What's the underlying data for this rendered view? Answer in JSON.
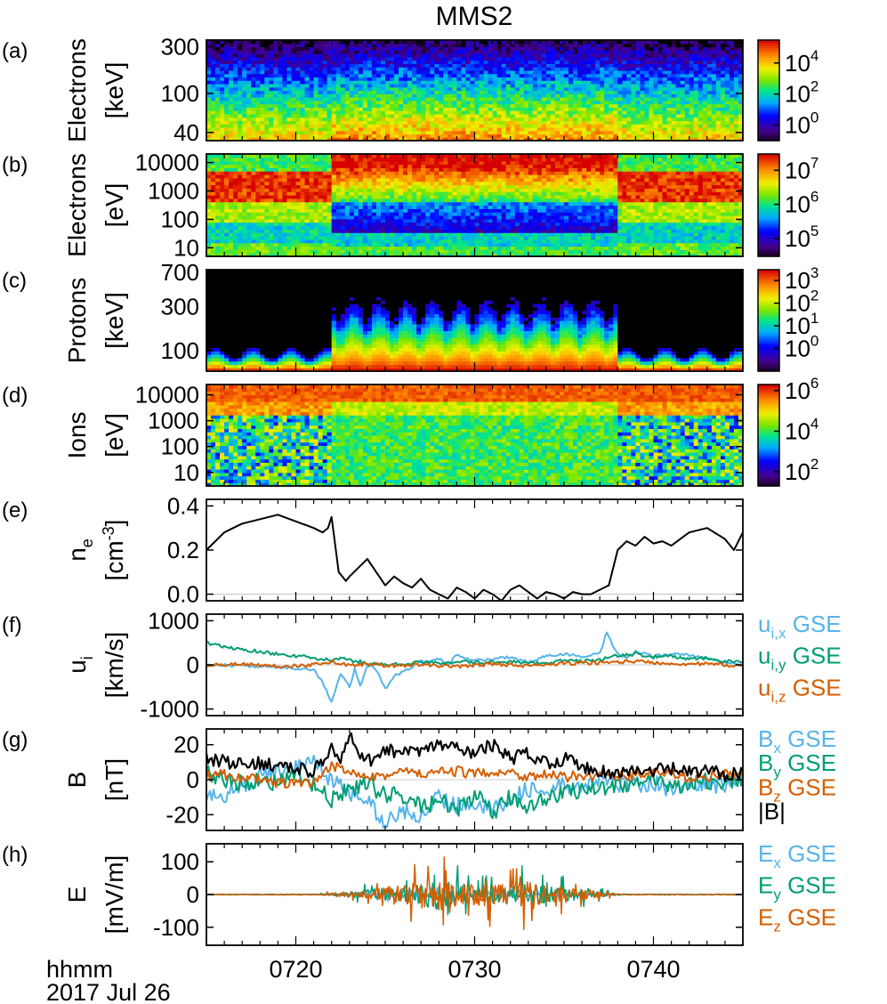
{
  "figure": {
    "title": "MMS2",
    "time_label": "hhmm",
    "date_label": "2017 Jul 26",
    "time_range": [
      "07:15",
      "07:45"
    ],
    "time_ticks": [
      {
        "t": 5,
        "label": "0720"
      },
      {
        "t": 15,
        "label": "0730"
      },
      {
        "t": 25,
        "label": "0740"
      }
    ]
  },
  "chart_data": [
    {
      "id": "a",
      "letter": "(a)",
      "type": "heatmap",
      "ylabel1": "Electrons",
      "ylabel2": "[keV]",
      "ylog": true,
      "ylim": [
        33,
        350
      ],
      "yticks": [
        {
          "v": 40,
          "label": "40"
        },
        {
          "v": 100,
          "label": "100"
        },
        {
          "v": 300,
          "label": "300"
        }
      ],
      "colorbar": {
        "log": true,
        "range": [
          0.1,
          300000
        ],
        "ticks": [
          {
            "v": 1,
            "base": "10",
            "exp": "0"
          },
          {
            "v": 100,
            "base": "10",
            "exp": "2"
          },
          {
            "v": 10000,
            "base": "10",
            "exp": "4"
          }
        ]
      }
    },
    {
      "id": "b",
      "letter": "(b)",
      "type": "heatmap",
      "ylabel1": "Electrons",
      "ylabel2": "[eV]",
      "ylog": true,
      "ylim": [
        5,
        20000
      ],
      "yticks": [
        {
          "v": 10,
          "label": "10"
        },
        {
          "v": 100,
          "label": "100"
        },
        {
          "v": 1000,
          "label": "1000"
        },
        {
          "v": 10000,
          "label": "10000"
        }
      ],
      "colorbar": {
        "log": true,
        "range": [
          30000,
          30000000
        ],
        "ticks": [
          {
            "v": 100000,
            "base": "10",
            "exp": "5"
          },
          {
            "v": 1000000,
            "base": "10",
            "exp": "6"
          },
          {
            "v": 10000000,
            "base": "10",
            "exp": "7"
          }
        ]
      }
    },
    {
      "id": "c",
      "letter": "(c)",
      "type": "heatmap",
      "ylabel1": "Protons",
      "ylabel2": "[keV]",
      "ylog": true,
      "ylim": [
        60,
        750
      ],
      "yticks": [
        {
          "v": 100,
          "label": "100"
        },
        {
          "v": 300,
          "label": "300"
        },
        {
          "v": 700,
          "label": "700"
        }
      ],
      "colorbar": {
        "log": true,
        "range": [
          0.1,
          3000
        ],
        "ticks": [
          {
            "v": 1,
            "base": "10",
            "exp": "0"
          },
          {
            "v": 10,
            "base": "10",
            "exp": "1"
          },
          {
            "v": 100,
            "base": "10",
            "exp": "2"
          },
          {
            "v": 1000,
            "base": "10",
            "exp": "3"
          }
        ]
      }
    },
    {
      "id": "d",
      "letter": "(d)",
      "type": "heatmap",
      "ylabel1": "Ions",
      "ylabel2": "[eV]",
      "ylog": true,
      "ylim": [
        3,
        25000
      ],
      "yticks": [
        {
          "v": 10,
          "label": "10"
        },
        {
          "v": 100,
          "label": "100"
        },
        {
          "v": 1000,
          "label": "1000"
        },
        {
          "v": 10000,
          "label": "10000"
        }
      ],
      "colorbar": {
        "log": true,
        "range": [
          20,
          2000000
        ],
        "ticks": [
          {
            "v": 100,
            "base": "10",
            "exp": "2"
          },
          {
            "v": 10000,
            "base": "10",
            "exp": "4"
          },
          {
            "v": 1000000,
            "base": "10",
            "exp": "6"
          }
        ]
      }
    },
    {
      "id": "e",
      "letter": "(e)",
      "type": "line",
      "ylabel1": "n",
      "ylabel1_sub": "e",
      "ylabel2": "[cm",
      "ylabel2_sup": "-3",
      "ylabel2_end": "]",
      "ylim": [
        -0.03,
        0.43
      ],
      "yticks": [
        {
          "v": 0.0,
          "label": "0.0"
        },
        {
          "v": 0.2,
          "label": "0.2"
        },
        {
          "v": 0.4,
          "label": "0.4"
        }
      ],
      "series": [
        {
          "color": "#000000",
          "width": 2,
          "x": [
            0,
            1,
            2,
            3,
            4,
            5,
            6,
            6.5,
            6.8,
            7,
            7.4,
            7.8,
            8,
            8.5,
            9,
            9.5,
            10,
            10.5,
            11,
            11.5,
            12,
            12.5,
            13,
            13.5,
            14,
            14.5,
            15,
            15.5,
            16,
            16.5,
            17,
            17.5,
            18,
            18.5,
            19,
            19.5,
            20,
            20.5,
            21,
            21.5,
            22,
            22.5,
            23,
            23.5,
            24,
            24.5,
            25,
            25.5,
            26,
            27,
            28,
            29,
            29.5,
            30
          ],
          "y": [
            0.2,
            0.28,
            0.32,
            0.34,
            0.36,
            0.33,
            0.3,
            0.28,
            0.3,
            0.35,
            0.1,
            0.06,
            0.08,
            0.12,
            0.16,
            0.1,
            0.04,
            0.08,
            0.05,
            0.03,
            0.07,
            0.02,
            0.0,
            -0.02,
            0.03,
            0.01,
            -0.02,
            0.02,
            0.0,
            -0.03,
            0.02,
            0.04,
            0.01,
            -0.02,
            0.01,
            0.0,
            -0.02,
            0.01,
            0.0,
            0.0,
            0.02,
            0.04,
            0.2,
            0.24,
            0.22,
            0.26,
            0.23,
            0.24,
            0.22,
            0.28,
            0.3,
            0.25,
            0.2,
            0.28
          ]
        }
      ]
    },
    {
      "id": "f",
      "letter": "(f)",
      "type": "line",
      "ylabel1": "u",
      "ylabel1_sub": "i",
      "ylabel2": "[km/s]",
      "ylim": [
        -1150,
        1150
      ],
      "yticks": [
        {
          "v": -1000,
          "label": "-1000"
        },
        {
          "v": 0,
          "label": "0"
        },
        {
          "v": 1000,
          "label": "1000"
        }
      ],
      "legend": [
        {
          "base": "u",
          "sub": "i,x",
          "suffix": " GSE",
          "color": "#56B4E9"
        },
        {
          "base": "u",
          "sub": "i,y",
          "suffix": " GSE",
          "color": "#009E73"
        },
        {
          "base": "u",
          "sub": "i,z",
          "suffix": " GSE",
          "color": "#D55E00"
        }
      ],
      "series": [
        {
          "color": "#56B4E9",
          "width": 2,
          "x": [
            0,
            2,
            4,
            6,
            6.5,
            7,
            7.5,
            8,
            8.3,
            8.6,
            9,
            9.5,
            10,
            10.5,
            11,
            11.5,
            12,
            12.5,
            13,
            13.5,
            14,
            14.5,
            15,
            16,
            17,
            18,
            19,
            20,
            21,
            22,
            22.4,
            22.8,
            23,
            23.5,
            24,
            25,
            26,
            27,
            28,
            29,
            30
          ],
          "y": [
            0,
            -20,
            -60,
            -100,
            -400,
            -850,
            -200,
            -500,
            -100,
            -500,
            0,
            -100,
            -550,
            -250,
            -150,
            -50,
            100,
            50,
            150,
            0,
            250,
            150,
            100,
            120,
            180,
            60,
            200,
            250,
            180,
            250,
            750,
            350,
            250,
            150,
            300,
            200,
            250,
            220,
            150,
            50,
            0
          ],
          "jitter": 30
        },
        {
          "color": "#009E73",
          "width": 2,
          "x": [
            0,
            0.5,
            1,
            2,
            3,
            4,
            5,
            6,
            7,
            7.5,
            8,
            9,
            10,
            11,
            12,
            13,
            14,
            15,
            16,
            17,
            18,
            19,
            20,
            21,
            22,
            23,
            24,
            25,
            26,
            27,
            28,
            29,
            30
          ],
          "y": [
            500,
            450,
            400,
            350,
            300,
            250,
            200,
            150,
            100,
            150,
            100,
            50,
            0,
            20,
            60,
            40,
            80,
            50,
            60,
            80,
            30,
            50,
            100,
            80,
            120,
            200,
            250,
            180,
            200,
            130,
            150,
            80,
            50
          ],
          "jitter": 40
        },
        {
          "color": "#D55E00",
          "width": 2,
          "x": [
            0,
            2,
            4,
            6,
            7,
            8,
            9,
            10,
            12,
            14,
            16,
            18,
            20,
            22,
            24,
            26,
            28,
            30
          ],
          "y": [
            0,
            20,
            -30,
            0,
            80,
            -20,
            30,
            -20,
            0,
            -40,
            20,
            -20,
            30,
            50,
            80,
            30,
            20,
            -20
          ],
          "jitter": 40
        }
      ]
    },
    {
      "id": "g",
      "letter": "(g)",
      "type": "line",
      "ylabel1": "B",
      "ylabel2": "[nT]",
      "ylim": [
        -29,
        29
      ],
      "yticks": [
        {
          "v": -20,
          "label": "-20"
        },
        {
          "v": 0,
          "label": "0"
        },
        {
          "v": 20,
          "label": "20"
        }
      ],
      "legend": [
        {
          "base": "B",
          "sub": "x",
          "suffix": " GSE",
          "color": "#56B4E9"
        },
        {
          "base": "B",
          "sub": "y",
          "suffix": " GSE",
          "color": "#009E73"
        },
        {
          "base": "B",
          "sub": "z",
          "suffix": " GSE",
          "color": "#D55E00"
        },
        {
          "base": "|B|",
          "sub": "",
          "suffix": "",
          "color": "#000000"
        }
      ],
      "series": [
        {
          "color": "#56B4E9",
          "width": 2,
          "x": [
            0,
            1,
            2,
            3,
            4,
            5,
            6,
            7,
            8,
            9,
            10,
            11,
            12,
            13,
            14,
            15,
            16,
            17,
            18,
            19,
            20,
            21,
            22,
            23,
            24,
            25,
            26,
            27,
            28,
            29,
            30
          ],
          "y": [
            -12,
            -8,
            -4,
            2,
            5,
            8,
            10,
            0,
            -8,
            -12,
            -25,
            -18,
            -20,
            -10,
            -15,
            -12,
            -18,
            -10,
            -5,
            -8,
            -3,
            -5,
            0,
            -2,
            -3,
            -2,
            -5,
            -3,
            -2,
            -4,
            2
          ],
          "jitter": 5
        },
        {
          "color": "#009E73",
          "width": 2,
          "x": [
            0,
            1,
            2,
            3,
            4,
            5,
            6,
            7,
            8,
            9,
            10,
            11,
            12,
            13,
            14,
            15,
            16,
            17,
            18,
            19,
            20,
            21,
            22,
            23,
            24,
            25,
            26,
            27,
            28,
            29,
            30
          ],
          "y": [
            4,
            0,
            -2,
            0,
            -2,
            2,
            -3,
            -12,
            -5,
            -3,
            -8,
            -10,
            -15,
            -12,
            -18,
            -8,
            -20,
            -10,
            -15,
            -10,
            -8,
            -5,
            -5,
            -3,
            -2,
            -2,
            -3,
            -2,
            -1,
            -2,
            0
          ],
          "jitter": 5
        },
        {
          "color": "#D55E00",
          "width": 2,
          "x": [
            0,
            1,
            2,
            3,
            4,
            5,
            6,
            7,
            8,
            9,
            10,
            11,
            12,
            13,
            14,
            15,
            16,
            17,
            18,
            19,
            20,
            21,
            22,
            23,
            24,
            25,
            26,
            27,
            28,
            29,
            30
          ],
          "y": [
            2,
            3,
            1,
            0,
            -2,
            -2,
            -3,
            8,
            5,
            3,
            2,
            5,
            3,
            4,
            5,
            3,
            5,
            4,
            2,
            3,
            1,
            3,
            2,
            2,
            3,
            4,
            3,
            1,
            2,
            3,
            2
          ],
          "jitter": 3
        },
        {
          "color": "#000000",
          "width": 2.2,
          "x": [
            0,
            1,
            2,
            3,
            4,
            5,
            6,
            7,
            7.5,
            8,
            8.5,
            9,
            10,
            11,
            12,
            13,
            14,
            15,
            16,
            17,
            18,
            19,
            20,
            21,
            22,
            23,
            24,
            25,
            26,
            27,
            28,
            29,
            30
          ],
          "y": [
            12,
            10,
            8,
            10,
            8,
            6,
            5,
            18,
            10,
            25,
            15,
            10,
            18,
            15,
            16,
            20,
            18,
            15,
            20,
            12,
            15,
            10,
            12,
            8,
            5,
            4,
            5,
            5,
            6,
            4,
            5,
            3,
            5
          ],
          "jitter": 4
        }
      ]
    },
    {
      "id": "h",
      "letter": "(h)",
      "type": "line",
      "ylabel1": "E",
      "ylabel2": "[mV/m]",
      "ylim": [
        -155,
        155
      ],
      "yticks": [
        {
          "v": -100,
          "label": "-100"
        },
        {
          "v": 0,
          "label": "0"
        },
        {
          "v": 100,
          "label": "100"
        }
      ],
      "legend": [
        {
          "base": "E",
          "sub": "x",
          "suffix": " GSE",
          "color": "#56B4E9"
        },
        {
          "base": "E",
          "sub": "y",
          "suffix": " GSE",
          "color": "#009E73"
        },
        {
          "base": "E",
          "sub": "z",
          "suffix": " GSE",
          "color": "#D55E00"
        }
      ],
      "series": [
        {
          "color": "#56B4E9",
          "width": 1.5,
          "x": [
            0,
            6,
            7,
            8,
            9,
            10,
            11,
            12,
            13,
            14,
            15,
            16,
            17,
            18,
            19,
            20,
            21,
            22,
            23,
            24,
            30
          ],
          "y": [
            0,
            0,
            5,
            10,
            15,
            20,
            30,
            25,
            20,
            25,
            30,
            25,
            30,
            20,
            25,
            15,
            10,
            5,
            2,
            0,
            0
          ],
          "burst": true
        },
        {
          "color": "#009E73",
          "width": 1.5,
          "x": [
            0,
            6,
            7,
            8,
            9,
            10,
            11,
            12,
            13,
            14,
            15,
            16,
            17,
            18,
            19,
            20,
            21,
            22,
            23,
            24,
            30
          ],
          "y": [
            0,
            0,
            10,
            20,
            40,
            60,
            70,
            90,
            140,
            90,
            70,
            80,
            60,
            120,
            70,
            60,
            40,
            20,
            5,
            0,
            0
          ],
          "burst": true
        },
        {
          "color": "#D55E00",
          "width": 1.5,
          "x": [
            0,
            6,
            7,
            8,
            9,
            10,
            11,
            12,
            13,
            14,
            15,
            16,
            17,
            18,
            19,
            20,
            21,
            22,
            23,
            24,
            30
          ],
          "y": [
            0,
            0,
            10,
            25,
            40,
            60,
            90,
            120,
            130,
            110,
            90,
            110,
            80,
            120,
            80,
            70,
            50,
            25,
            5,
            0,
            0
          ],
          "burst": true
        }
      ]
    }
  ]
}
